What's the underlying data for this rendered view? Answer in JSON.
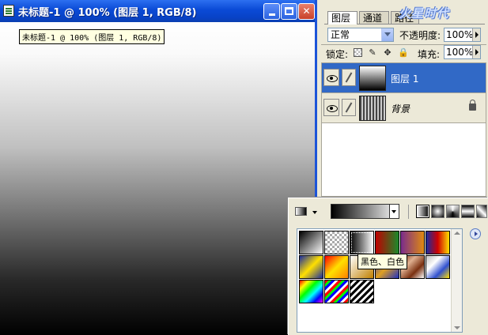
{
  "document": {
    "title": "未标题-1 @ 100% (图层 1, RGB/8)",
    "tooltip": "未标题-1 @ 100% (图层 1, RGB/8)"
  },
  "layers_panel": {
    "tabs": [
      "图层",
      "通道",
      "路径"
    ],
    "watermark": "火星时代",
    "blend_mode": "正常",
    "opacity_label": "不透明度:",
    "opacity_value": "100%",
    "lock_label": "锁定:",
    "fill_label": "填充:",
    "fill_value": "100%",
    "layers": [
      {
        "name": "图层 1",
        "selected": true,
        "thumb": "gradient"
      },
      {
        "name": "背景",
        "selected": false,
        "thumb": "stripes",
        "locked": true
      }
    ]
  },
  "gradient_panel": {
    "tooltip": "黑色、白色",
    "presets": [
      "linear-gradient(135deg,#000,#fff)",
      "repeating-conic-gradient(#aaa 0% 25%,#fff 0% 50%) 0 0/6px 6px",
      "linear-gradient(90deg,#000,#fff)",
      "linear-gradient(90deg,#c00000,#1a8a2a)",
      "linear-gradient(90deg,#7a2c8c,#e08a10)",
      "linear-gradient(90deg,#1a2ca0,#d00000,#ffe000)",
      "linear-gradient(135deg,#1a2ca0,#ffe000 50%,#1a2ca0)",
      "linear-gradient(135deg,#ff0000,#ffe000 50%,#ff8000)",
      "linear-gradient(135deg,#ffffff,#c08000)",
      "linear-gradient(135deg,#2030c0,#e0a020,#2030c0)",
      "linear-gradient(135deg,#7a3010,#e0b090,#7a3010,#ffffff)",
      "linear-gradient(135deg,#c0c0c0,#ffffff,#3050d0,#ffe000)",
      "linear-gradient(135deg,#ff0000,#ffff00,#00ff00,#00ffff,#0000ff,#ff00ff)",
      "repeating-linear-gradient(135deg,#ff0000 0 3px,#00ff00 3px 6px,#0000ff 6px 9px,transparent 9px 12px)",
      "repeating-linear-gradient(135deg,#000 0 3px,#fff 3px 6px)"
    ]
  }
}
